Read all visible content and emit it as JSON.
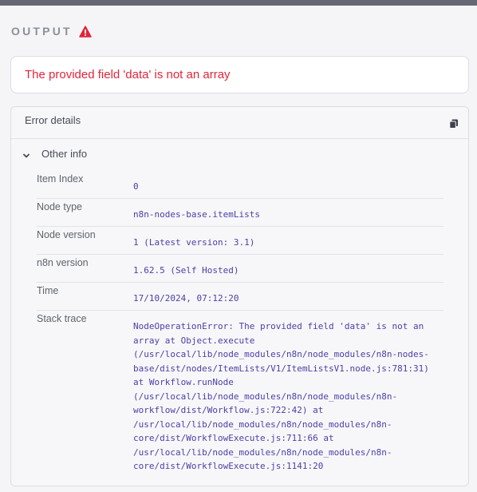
{
  "output": {
    "label": "OUTPUT",
    "warning_icon": "warning-triangle-icon",
    "warning_color": "#e0263b"
  },
  "error": {
    "message": "The provided field 'data' is not an array"
  },
  "details": {
    "title": "Error details",
    "copy_icon": "copy-icon",
    "section_label": "Other info",
    "rows": [
      {
        "key": "Item Index",
        "value": "0"
      },
      {
        "key": "Node type",
        "value": "n8n-nodes-base.itemLists"
      },
      {
        "key": "Node version",
        "value": "1 (Latest version: 3.1)"
      },
      {
        "key": "n8n version",
        "value": "1.62.5 (Self Hosted)"
      },
      {
        "key": "Time",
        "value": "17/10/2024, 07:12:20"
      },
      {
        "key": "Stack trace",
        "value": "NodeOperationError: The provided field 'data' is not an\narray at Object.execute\n(/usr/local/lib/node_modules/n8n/node_modules/n8n-nodes-\nbase/dist/nodes/ItemLists/V1/ItemListsV1.node.js:781:31)\nat Workflow.runNode\n(/usr/local/lib/node_modules/n8n/node_modules/n8n-\nworkflow/dist/Workflow.js:722:42) at\n/usr/local/lib/node_modules/n8n/node_modules/n8n-\ncore/dist/WorkflowExecute.js:711:66 at\n/usr/local/lib/node_modules/n8n/node_modules/n8n-\ncore/dist/WorkflowExecute.js:1141:20"
      }
    ]
  }
}
